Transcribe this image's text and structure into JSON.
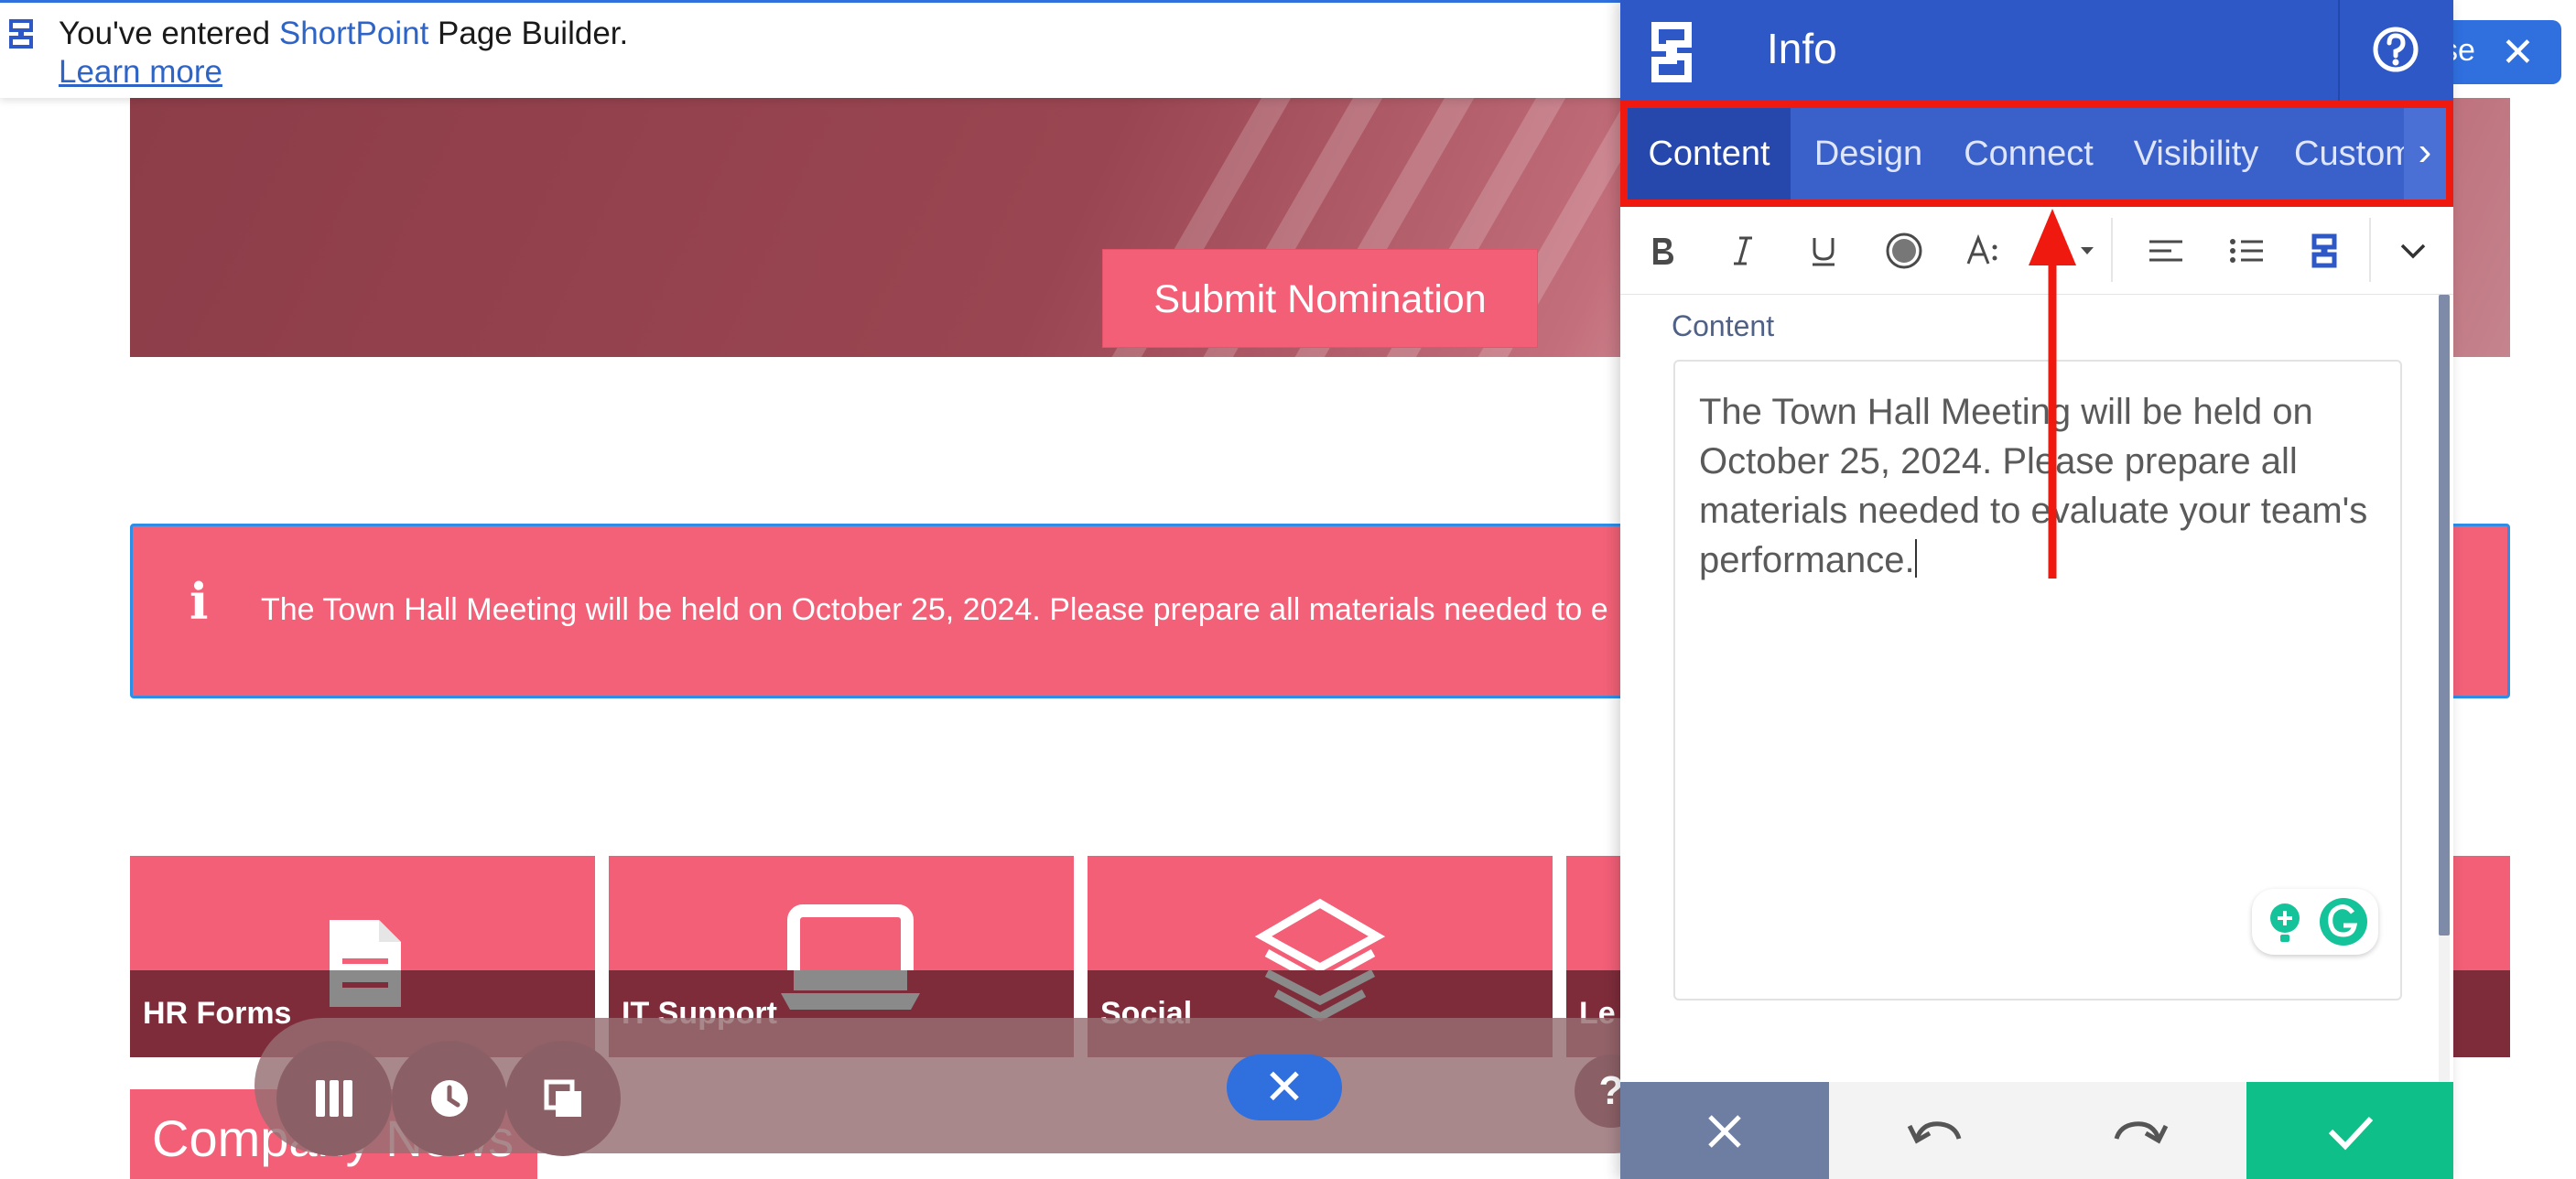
{
  "notification": {
    "text_before": "You've entered ",
    "brand": "ShortPoint",
    "text_after": " Page Builder.",
    "link": "Learn more"
  },
  "close_button": {
    "label": "se",
    "icon": "close-icon"
  },
  "hero": {
    "button_label": "Submit Nomination"
  },
  "info_banner": {
    "icon": "info-icon",
    "text": "The Town Hall Meeting will be held on October 25, 2024. Please prepare all materials needed to e"
  },
  "tiles": [
    {
      "label": "HR Forms",
      "icon": "document-icon"
    },
    {
      "label": "IT Support",
      "icon": "laptop-icon"
    },
    {
      "label": "Social",
      "icon": "layers-icon"
    },
    {
      "label": "Le",
      "icon": ""
    }
  ],
  "company_news": {
    "title": "Company News"
  },
  "floating_toolbar": {
    "buttons": [
      "columns-icon",
      "clock-icon",
      "copy-icon"
    ],
    "close_icon": "close-icon",
    "help_label": "?"
  },
  "panel": {
    "title": "Info",
    "logo": "shortpoint-logo-icon",
    "help_icon": "help-circle-icon",
    "tabs": [
      {
        "label": "Content",
        "active": true
      },
      {
        "label": "Design",
        "active": false
      },
      {
        "label": "Connect",
        "active": false
      },
      {
        "label": "Visibility",
        "active": false
      },
      {
        "label": "Custom",
        "active": false
      }
    ],
    "tab_more_icon": "chevron-right-icon",
    "format_toolbar": [
      "bold-icon",
      "italic-icon",
      "underline-icon",
      "color-circle-icon",
      "font-size-icon",
      "highlight-icon",
      "align-left-icon",
      "list-icon",
      "shortpoint-icon",
      "chevron-down-icon"
    ],
    "content_label": "Content",
    "content_text": "The Town Hall Meeting will be held on October 25, 2024. Please prepare all materials needed to evaluate your team's performance.",
    "footer": {
      "cancel_icon": "close-icon",
      "undo_icon": "undo-icon",
      "redo_icon": "redo-icon",
      "confirm_icon": "check-icon"
    }
  },
  "colors": {
    "accent_blue": "#2f58c7",
    "tile_pink": "#f25f77",
    "confirm_green": "#0fbf89",
    "annotation_red": "#f0190f"
  }
}
